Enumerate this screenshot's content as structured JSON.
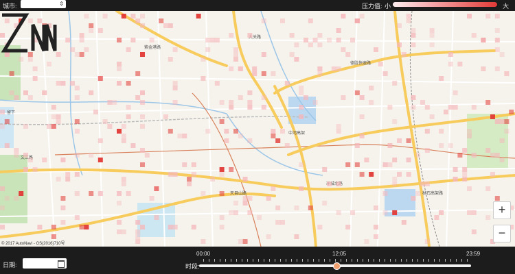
{
  "topbar": {
    "city_label": "城市:",
    "city_value": "",
    "pressure_label": "压力值:",
    "legend_low": "小",
    "legend_high": "大",
    "legend_colors": [
      "#fdeef0",
      "#f5a3a5",
      "#e23a36"
    ]
  },
  "map": {
    "brand_logo": "ZN",
    "copyright": "© 2017 AutoNavi - GS(2016)710号",
    "zoom_in": "+",
    "zoom_out": "−",
    "place_labels": [
      "大关路",
      "德胜快速路",
      "环城北路",
      "天目山路",
      "文三路",
      "秋石高架路",
      "中河高架",
      "留下",
      "紫金港路"
    ]
  },
  "bottombar": {
    "date_label": "日期:",
    "date_value": "",
    "time_label": "时段:",
    "time_start": "00:00",
    "time_current": "12:05",
    "time_end": "23:59",
    "time_current_fraction": 0.505
  },
  "colors": {
    "bar_bg": "#1c1c1c",
    "map_bg": "#f6f3ec",
    "major_road": "#f7cb5c",
    "heat_strong": "#e23a36",
    "heat_light": "#f5b8bb"
  }
}
